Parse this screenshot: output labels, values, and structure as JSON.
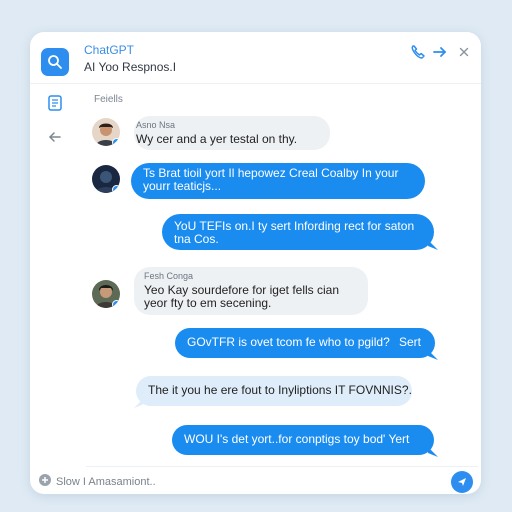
{
  "header": {
    "title": "ChatGPT",
    "subtitle": "AI Yoo Respnos.I"
  },
  "section_label": "Feiells",
  "messages": [
    {
      "sender": "Asno Nsa",
      "text": "Wy cer and a yer testal on thy.",
      "direction": "in"
    },
    {
      "text": "Ts Brat tioil yort Il hepowez Creal Coalby In your yourr teaticjs...",
      "direction": "out"
    },
    {
      "text": "YoU TEFIs on.I ty sert Infording rect for saton tna Cos.",
      "direction": "out"
    },
    {
      "sender": "Fesh Conga",
      "text": "Yeo Kay sourdefore for iget fells cian yeor fty to em secening.",
      "direction": "in"
    },
    {
      "text": "GOvTFR is ovet tcom fe who to pgild?",
      "meta": "Sert",
      "direction": "out"
    },
    {
      "text": "The it you he ere fout to Inyliptions IT FOVNNIS?.",
      "direction": "in"
    },
    {
      "text": "WOU I's det yort..for conptigs toy bod' Yert",
      "direction": "out"
    }
  ],
  "compose": {
    "placeholder": "Slow I Amasamiont.."
  },
  "colors": {
    "accent": "#2d8ef0",
    "outgoing_bubble": "#1a8cf0",
    "incoming_bubble": "#eef1f4"
  },
  "icons": [
    "search-icon",
    "phone-icon",
    "arrow-right-icon",
    "close-icon",
    "document-icon",
    "arrow-left-icon",
    "attach-icon",
    "send-icon"
  ]
}
